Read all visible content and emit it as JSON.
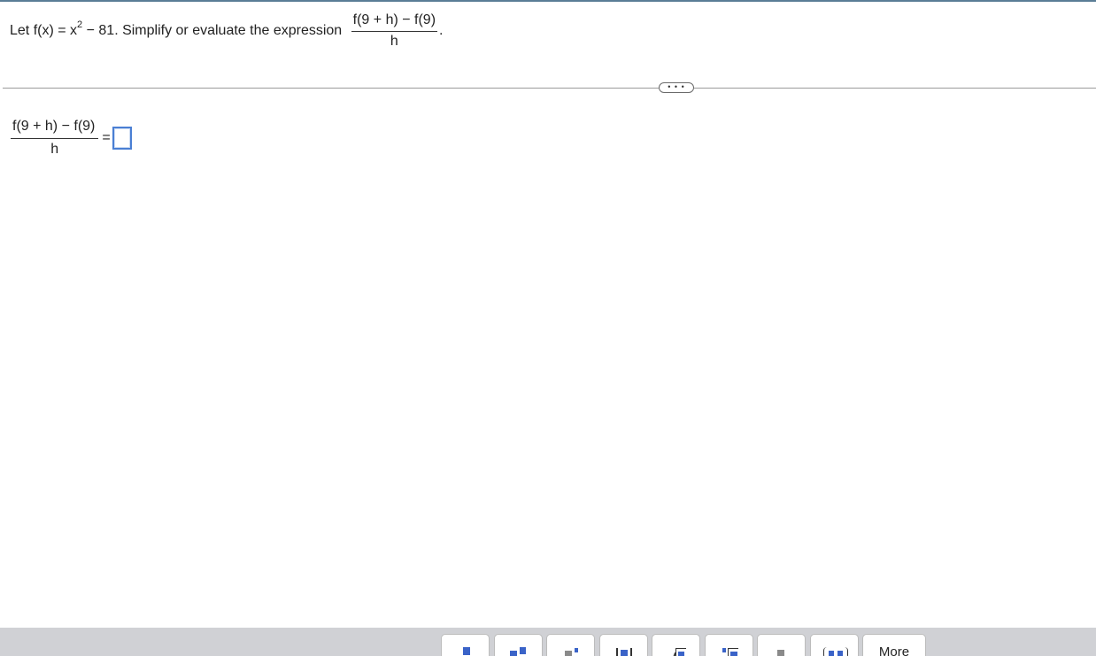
{
  "question": {
    "prefix": "Let f(x) = x",
    "exponent": "2",
    "middle": " − 81. Simplify or evaluate the expression ",
    "numerator": "f(9 + h) − f(9)",
    "denominator": "h",
    "suffix": "."
  },
  "divider": {
    "more_label": "• • •"
  },
  "answer": {
    "numerator": "f(9 + h) − f(9)",
    "denominator": "h",
    "equals": "="
  },
  "palette": {
    "buttons": [
      "fraction-icon",
      "mixed-number-icon",
      "exponent-icon",
      "absolute-value-icon",
      "square-root-icon",
      "nth-root-icon",
      "decimal-point-icon",
      "ordered-pair-icon"
    ],
    "more_label": "More"
  },
  "colors": {
    "accent": "#3a63c8",
    "toolbar_bg": "#d0d1d5",
    "top_rule": "#5a7d96"
  }
}
